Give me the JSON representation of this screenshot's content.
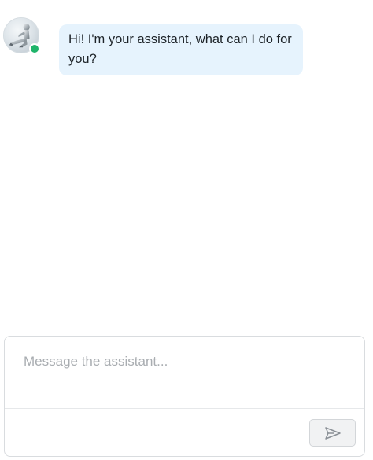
{
  "chat": {
    "messages": [
      {
        "sender": "assistant",
        "text": "Hi! I'm your assistant, what can I do for you?",
        "avatar_icon": "robot-figure-avatar",
        "status": "online",
        "status_color": "#1fb46a",
        "bubble_color": "#e6f3fd"
      }
    ]
  },
  "composer": {
    "value": "",
    "placeholder": "Message the assistant...",
    "send_icon": "send-paper-plane-icon",
    "send_enabled": false
  }
}
